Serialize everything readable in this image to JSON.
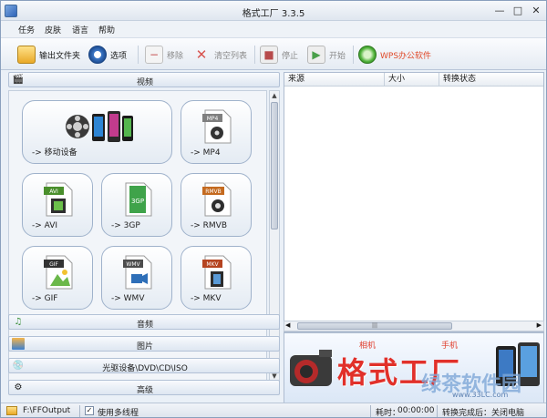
{
  "window": {
    "title": "格式工厂  3.3.5",
    "minimize": "—",
    "maximize": "□",
    "close": "✕"
  },
  "menu": [
    "任务",
    "皮肤",
    "语言",
    "帮助"
  ],
  "toolbar": {
    "output_folder": "输出文件夹",
    "options": "选项",
    "remove": "移除",
    "clear_list": "清空列表",
    "stop": "停止",
    "start": "开始",
    "wps": "WPS办公软件"
  },
  "categories": {
    "video": "视频",
    "audio": "音频",
    "image": "图片",
    "disc": "光驱设备\\DVD\\CD\\ISO",
    "advanced": "高级"
  },
  "formats": [
    {
      "label": "-> 移动设备",
      "badge": ""
    },
    {
      "label": "-> MP4",
      "badge": "MP4"
    },
    {
      "label": "-> AVI",
      "badge": "AVI"
    },
    {
      "label": "-> 3GP",
      "badge": "3GP"
    },
    {
      "label": "-> RMVB",
      "badge": "RMVB"
    },
    {
      "label": "-> GIF",
      "badge": "GIF"
    },
    {
      "label": "-> WMV",
      "badge": "WMV"
    },
    {
      "label": "-> MKV",
      "badge": "MKV"
    }
  ],
  "task_list": {
    "columns": [
      "来源",
      "大小",
      "转换状态"
    ]
  },
  "banner": {
    "brand": "格式工厂",
    "tag1": "相机",
    "tag2": "手机",
    "watermark": "绿茶软件园",
    "url": "www.33LC.com"
  },
  "status": {
    "output_path": "F:\\FFOutput",
    "multithread_label": "使用多线程",
    "multithread_checked": "✓",
    "elapsed_label": "耗时：",
    "elapsed_value": "00:00:00",
    "after_convert": "转换完成后：关闭电脑"
  },
  "colors": {
    "accent": "#2f64b8",
    "brand_red": "#e1302a"
  }
}
